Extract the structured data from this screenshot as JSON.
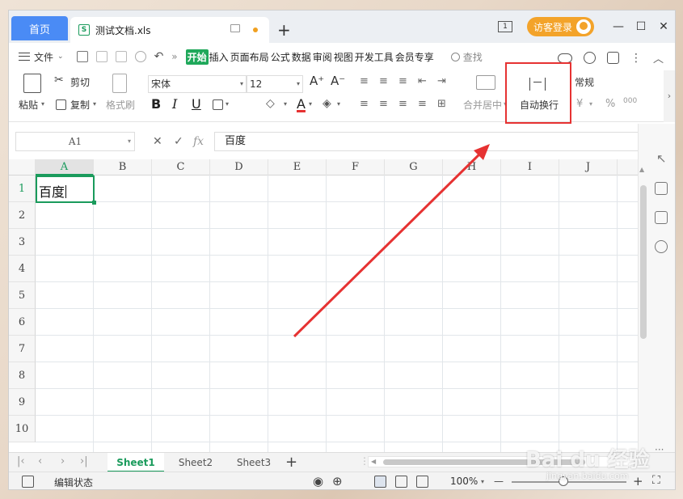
{
  "titlebar": {
    "home_tab": "首页",
    "doc_icon": "S",
    "doc_title": "测试文档.xls",
    "new_tab": "+",
    "page_num": "1",
    "login_label": "访客登录",
    "minimize": "—",
    "maximize": "☐",
    "close": "✕"
  },
  "menubar": {
    "file_label": "文件",
    "tabs": [
      "开始",
      "插入",
      "页面布局",
      "公式",
      "数据",
      "审阅",
      "视图",
      "开发工具",
      "会员专享"
    ],
    "active_tab": "开始",
    "search_label": "查找"
  },
  "ribbon": {
    "paste": "粘贴",
    "cut": "剪切",
    "copy": "复制",
    "format_painter": "格式刷",
    "font_name": "宋体",
    "font_size": "12",
    "bold": "B",
    "italic": "I",
    "underline": "U",
    "font_color": "A",
    "merge_center": "合并居中",
    "wrap_text": "自动换行",
    "number_format": "常规",
    "currency": "¥",
    "percent": "%",
    "thousands": "000",
    "grow_font": "A⁺",
    "shrink_font": "A⁻"
  },
  "formula_bar": {
    "name_box": "A1",
    "cancel": "✕",
    "confirm": "✓",
    "fx": "fx",
    "content": "百度"
  },
  "grid": {
    "columns": [
      "A",
      "B",
      "C",
      "D",
      "E",
      "F",
      "G",
      "H",
      "I",
      "J"
    ],
    "rows": [
      "1",
      "2",
      "3",
      "4",
      "5",
      "6",
      "7",
      "8",
      "9",
      "10"
    ],
    "a1_value": "百度"
  },
  "sheets": {
    "tabs": [
      "Sheet1",
      "Sheet2",
      "Sheet3"
    ],
    "active": "Sheet1",
    "add": "+"
  },
  "statusbar": {
    "status": "编辑状态",
    "zoom": "100%",
    "zoom_fraction": 0.45,
    "minus": "—",
    "plus": "+"
  },
  "watermark": {
    "text": "Bai du 经验",
    "sub": "jingyan.baidu.com"
  },
  "colors": {
    "accent_green": "#1a9b5c",
    "home_tab_blue": "#4a8bf5",
    "login_orange": "#f3a32a",
    "highlight_red": "#e63232"
  }
}
